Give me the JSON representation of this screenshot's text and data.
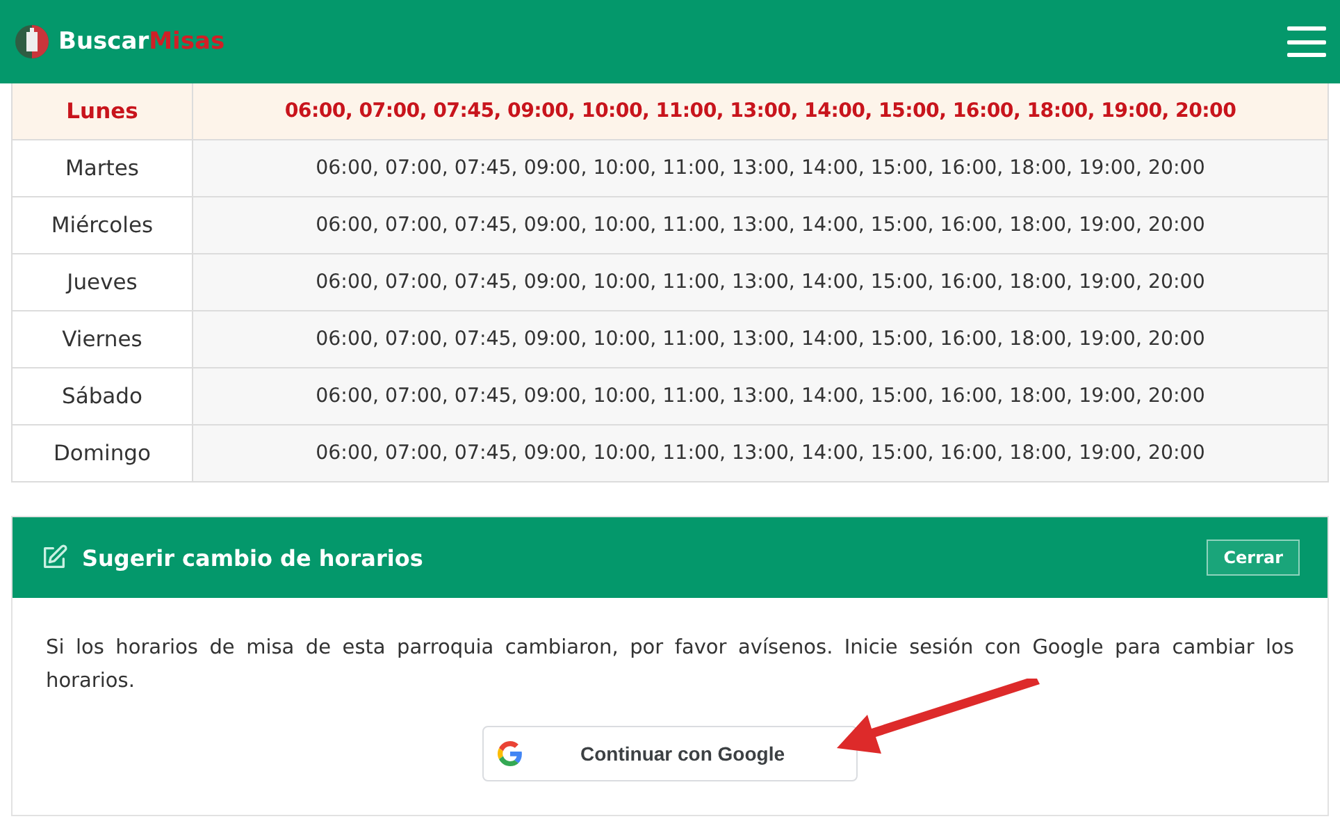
{
  "header": {
    "brand_first": "Buscar",
    "brand_second": "Misas"
  },
  "schedule": [
    {
      "day": "Lunes",
      "times": "06:00, 07:00, 07:45, 09:00, 10:00, 11:00, 13:00, 14:00, 15:00, 16:00, 18:00, 19:00, 20:00",
      "selected": true
    },
    {
      "day": "Martes",
      "times": "06:00, 07:00, 07:45, 09:00, 10:00, 11:00, 13:00, 14:00, 15:00, 16:00, 18:00, 19:00, 20:00",
      "selected": false
    },
    {
      "day": "Miércoles",
      "times": "06:00, 07:00, 07:45, 09:00, 10:00, 11:00, 13:00, 14:00, 15:00, 16:00, 18:00, 19:00, 20:00",
      "selected": false
    },
    {
      "day": "Jueves",
      "times": "06:00, 07:00, 07:45, 09:00, 10:00, 11:00, 13:00, 14:00, 15:00, 16:00, 18:00, 19:00, 20:00",
      "selected": false
    },
    {
      "day": "Viernes",
      "times": "06:00, 07:00, 07:45, 09:00, 10:00, 11:00, 13:00, 14:00, 15:00, 16:00, 18:00, 19:00, 20:00",
      "selected": false
    },
    {
      "day": "Sábado",
      "times": "06:00, 07:00, 07:45, 09:00, 10:00, 11:00, 13:00, 14:00, 15:00, 16:00, 18:00, 19:00, 20:00",
      "selected": false
    },
    {
      "day": "Domingo",
      "times": "06:00, 07:00, 07:45, 09:00, 10:00, 11:00, 13:00, 14:00, 15:00, 16:00, 18:00, 19:00, 20:00",
      "selected": false
    }
  ],
  "suggest_card": {
    "title": "Sugerir cambio de horarios",
    "close_button": "Cerrar",
    "message": "Si los horarios de misa de esta parroquia cambiaron, por favor avísenos. Inicie sesión con Google para cambiar los horarios.",
    "google_button": "Continuar con Google"
  }
}
